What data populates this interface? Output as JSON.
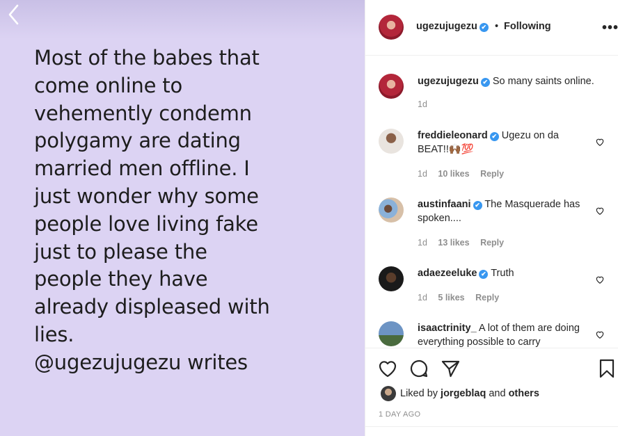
{
  "post": {
    "quote": "Most of the babes that\ncome online to\nvehemently condemn\npolygamy are dating\nmarried men offline. I\njust wonder why some\npeople love living fake\njust to please the\npeople they have\nalready displeased with\nlies.\n@ugezujugezu writes",
    "background_color": "#dcd3f3"
  },
  "header": {
    "username": "ugezujugezu",
    "verified_glyph": "✔",
    "separator": "•",
    "follow_status": "Following",
    "more_label": "•••"
  },
  "caption": {
    "username": "ugezujugezu",
    "verified_glyph": "✔",
    "text": "So many saints online.",
    "time": "1d"
  },
  "comments": [
    {
      "username": "freddieleonard",
      "text": "Ugezu on da BEAT!!🙌🏾💯",
      "time": "1d",
      "likes": "10 likes",
      "reply": "Reply"
    },
    {
      "username": "austinfaani",
      "text": "The Masquerade has spoken....",
      "time": "1d",
      "likes": "13 likes",
      "reply": "Reply"
    },
    {
      "username": "adaezeeluke",
      "text": "Truth",
      "time": "1d",
      "likes": "5 likes",
      "reply": "Reply"
    },
    {
      "username": "isaactrinity_",
      "text": "A lot of them are doing everything possible to carry",
      "time": "",
      "likes": "",
      "reply": ""
    }
  ],
  "likes_summary": {
    "prefix": "Liked by",
    "user": "jorgeblaq",
    "and": "and",
    "others": "others"
  },
  "timestamp": "1 DAY AGO",
  "icons": [
    "back-arrow-icon",
    "more-options-icon",
    "heart-icon",
    "comment-icon",
    "share-icon",
    "bookmark-icon",
    "verified-icon"
  ]
}
